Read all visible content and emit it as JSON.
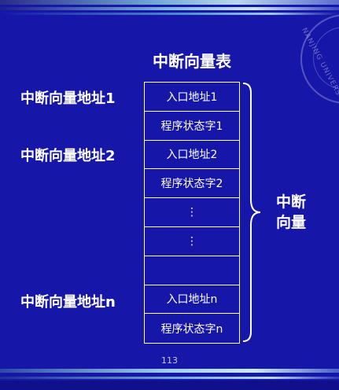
{
  "title": "中断向量表",
  "labels": {
    "addr1": "中断向量地址1",
    "addr2": "中断向量地址2",
    "addrn": "中断向量地址n"
  },
  "cells": [
    "入口地址1",
    "程序状态字1",
    "入口地址2",
    "程序状态字2",
    "⋮",
    "⋮",
    "",
    "入口地址n",
    "程序状态字n"
  ],
  "brace_label": [
    "中断",
    "向量"
  ],
  "page_number": "113",
  "seal_text": "NANJING UNIVERS",
  "colors": {
    "background": "#1616a8",
    "foreground": "#ffffff"
  }
}
